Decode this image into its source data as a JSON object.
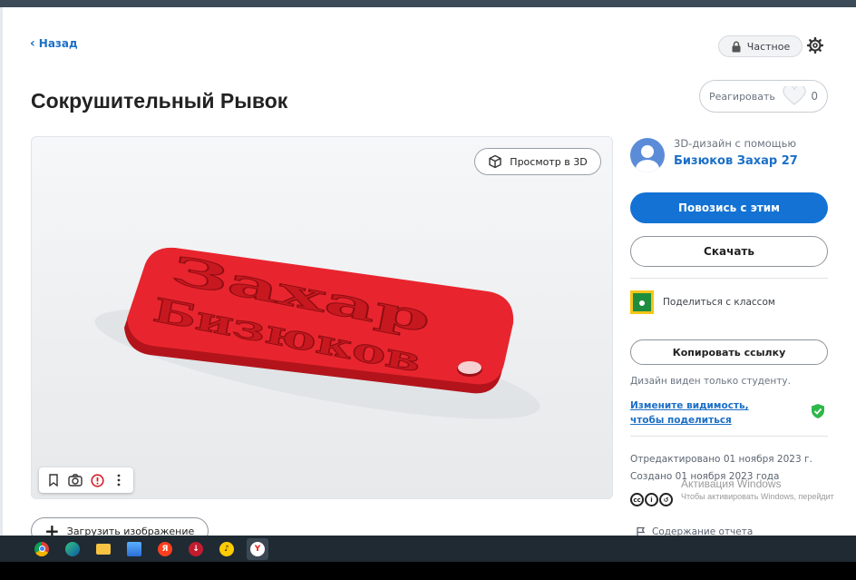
{
  "nav": {
    "back_label": "Назад"
  },
  "privacy": {
    "label": "Частное",
    "icon": "lock-icon"
  },
  "project": {
    "title": "Сокрушительный Рывок",
    "model_text_line1": "Захар",
    "model_text_line2": "Бизюков",
    "model_color": "#e8252e"
  },
  "reaction": {
    "label": "Реагировать",
    "count": "0"
  },
  "viewer": {
    "view3d_label": "Просмотр в 3D"
  },
  "upload": {
    "label": "Загрузить изображение"
  },
  "author": {
    "by_label": "3D-дизайн с помощью",
    "name": "Бизюков Захар 27"
  },
  "actions": {
    "tinker_label": "Повозись с этим",
    "download_label": "Скачать",
    "share_class_label": "Поделиться с классом",
    "copy_link_label": "Копировать ссылку",
    "visibility_note": "Дизайн виден только студенту.",
    "change_visibility_label": "Измените видимость, чтобы поделиться"
  },
  "meta": {
    "edited": "Отредактировано 01 ноября 2023 г.",
    "created": "Создано 01 ноября 2023 года",
    "report_label": "Содержание отчета"
  },
  "windows": {
    "activation_title": "Активация Windows",
    "activation_sub": "Чтобы активировать Windows, перейдит"
  },
  "taskbar": {
    "apps": [
      "chrome-icon",
      "edge-icon",
      "file-explorer-icon",
      "app-icon",
      "yandex-icon",
      "download-manager-icon",
      "yandex-music-icon",
      "yandex-browser-icon"
    ]
  },
  "colors": {
    "accent": "#1372d4",
    "link": "#1b6fc7",
    "success": "#2fb84a"
  }
}
